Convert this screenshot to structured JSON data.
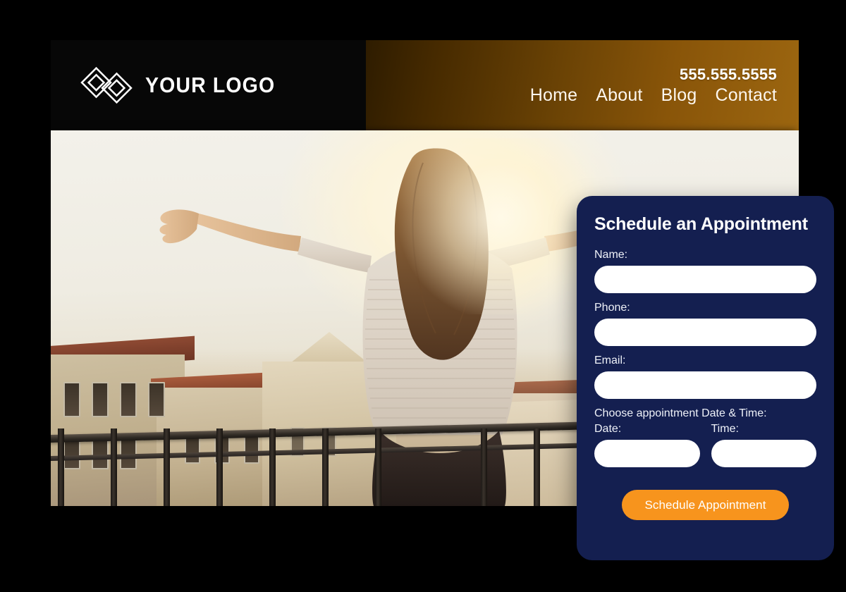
{
  "header": {
    "logo": {
      "icon": "interlocking-diamonds-logo-icon",
      "wordmark": "YOUR LOGO"
    },
    "phone": "555.555.5555",
    "nav_items": [
      {
        "label": "Home"
      },
      {
        "label": "About"
      },
      {
        "label": "Blog"
      },
      {
        "label": "Contact"
      }
    ],
    "colors": {
      "logo_zone_bg": "#070707",
      "nav_gradient_start": "#2e1c00",
      "nav_gradient_end": "#9c6610",
      "nav_text": "#fdf7ef"
    }
  },
  "hero": {
    "photo_description": "Woman seen from behind standing on a balcony with arms outstretched, facing a bright sunrise over city rooftops",
    "background_color": "#eceae2"
  },
  "form": {
    "title": "Schedule an Appointment",
    "fields": [
      {
        "label": "Name:",
        "value": "",
        "placeholder": ""
      },
      {
        "label": "Phone:",
        "value": "",
        "placeholder": ""
      },
      {
        "label": "Email:",
        "value": "",
        "placeholder": ""
      }
    ],
    "datetime_section_label": "Choose appointment Date & Time:",
    "date_label": "Date:",
    "date_value": "",
    "date_placeholder": "",
    "time_label": "Time:",
    "time_value": "",
    "time_placeholder": "",
    "submit_label": "Schedule Appointment",
    "colors": {
      "card_bg": "#141f50",
      "input_bg": "#ffffff",
      "submit_bg": "#f7941d",
      "label_text": "#eef1f8"
    }
  },
  "page": {
    "background_color": "#000000"
  }
}
